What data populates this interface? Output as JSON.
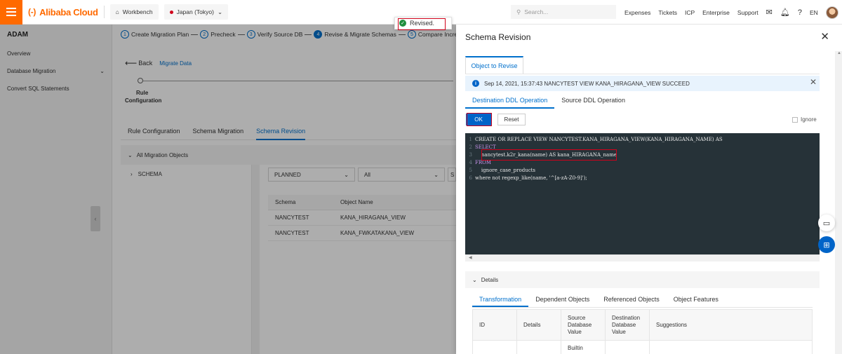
{
  "topbar": {
    "brand": "Alibaba Cloud",
    "workbench": "Workbench",
    "region": "Japan (Tokyo)",
    "search_placeholder": "Search...",
    "nav": [
      "Expenses",
      "Tickets",
      "ICP",
      "Enterprise",
      "Support"
    ],
    "language": "EN"
  },
  "sidebar": {
    "title": "ADAM",
    "items": [
      {
        "label": "Overview"
      },
      {
        "label": "Database Migration"
      },
      {
        "label": "Convert SQL Statements"
      }
    ]
  },
  "main": {
    "steps": [
      {
        "num": "1",
        "label": "Create Migration Plan"
      },
      {
        "num": "2",
        "label": "Precheck"
      },
      {
        "num": "3",
        "label": "Verify Source DB"
      },
      {
        "num": "4",
        "label": "Revise & Migrate Schemas"
      },
      {
        "num": "5",
        "label": "Compare Increment"
      }
    ],
    "back_label": "Back",
    "migrate_link": "Migrate Data",
    "rule_step": [
      "Rule",
      "Configuration"
    ],
    "tabs": [
      "Rule Configuration",
      "Schema Migration",
      "Schema Revision"
    ],
    "all_objects": "All Migration Objects",
    "tree_item": "SCHEMA",
    "filter_status": "PLANNED",
    "filter_all": "All",
    "filter_third": "S",
    "table": {
      "headers": [
        "Schema",
        "Object Name"
      ],
      "rows": [
        [
          "NANCYTEST",
          "KANA_HIRAGANA_VIEW"
        ],
        [
          "NANCYTEST",
          "KANA_FWKATAKANA_VIEW"
        ]
      ]
    }
  },
  "toast": {
    "message": "Revised."
  },
  "panel": {
    "title": "Schema Revision",
    "object_tab": "Object to Revise",
    "info_message": "Sep 14, 2021, 15:37:43 NANCYTEST VIEW KANA_HIRAGANA_VIEW SUCCEED",
    "ddl_tabs": [
      "Destination DDL Operation",
      "Source DDL Operation"
    ],
    "ok_label": "OK",
    "reset_label": "Reset",
    "ignore_label": "Ignore",
    "code": [
      {
        "n": "1",
        "t": "CREATE OR REPLACE VIEW NANCYTEST.KANA_HIRAGANA_VIEW(KANA_HIRAGANA_NAME) AS"
      },
      {
        "n": "2",
        "t": "SELECT"
      },
      {
        "n": "3",
        "t": "    nancytest.k2r_kana(name) AS kana_HIRAGANA_name"
      },
      {
        "n": "4",
        "t": "FROM"
      },
      {
        "n": "5",
        "t": "    ignore_case_products"
      },
      {
        "n": "6",
        "t": "where not regexp_like(name, '^[a-zA-Z0-9]');"
      }
    ],
    "details_label": "Details",
    "detail_tabs": [
      "Transformation",
      "Dependent Objects",
      "Referenced Objects",
      "Object Features"
    ],
    "detail_table": {
      "headers": [
        "ID",
        "Details",
        "Source Database Value",
        "Destination Database Value",
        "Suggestions"
      ],
      "row1": [
        "",
        "",
        "Builtin",
        "",
        ""
      ]
    }
  },
  "colors": {
    "brand": "#ff6a00",
    "primary": "#0064c8",
    "highlight": "#d0021b",
    "editor_bg": "#263238"
  }
}
